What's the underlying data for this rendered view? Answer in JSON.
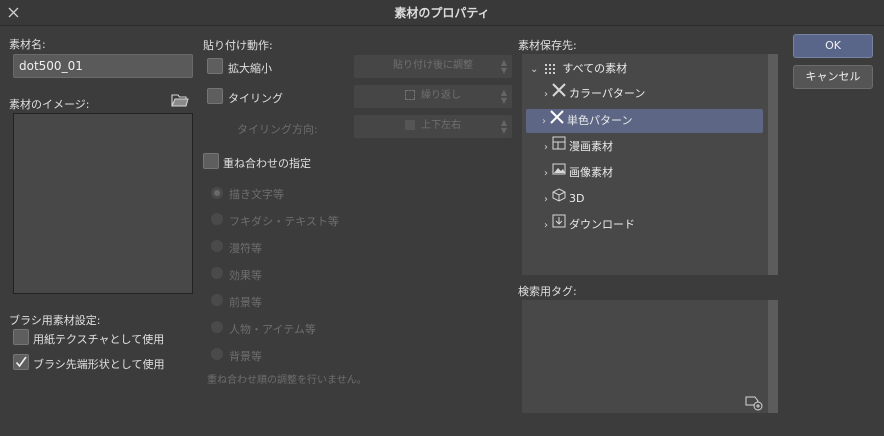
{
  "window": {
    "title": "素材のプロパティ"
  },
  "left": {
    "name_label": "素材名:",
    "name_value": "dot500_01",
    "image_label": "素材のイメージ:",
    "brush_section_label": "ブラシ用素材設定:",
    "paper_texture_label": "用紙テクスチャとして使用",
    "brush_tip_label": "ブラシ先端形状として使用"
  },
  "paste": {
    "section_label": "貼り付け動作:",
    "scale_label": "拡大縮小",
    "scale_combo": "貼り付け後に調整",
    "tiling_label": "タイリング",
    "tiling_combo": "繰り返し",
    "tiling_dir_label": "タイリング方向:",
    "tiling_dir_combo": "上下左右",
    "overlay_label": "重ね合わせの指定",
    "radios": [
      "描き文字等",
      "フキダシ・テキスト等",
      "漫符等",
      "効果等",
      "前景等",
      "人物・アイテム等",
      "背景等"
    ],
    "overlay_note": "重ね合わせ順の調整を行いません。"
  },
  "storage": {
    "section_label": "素材保存先:",
    "root": "すべての素材",
    "items": [
      "カラーパターン",
      "単色パターン",
      "漫画素材",
      "画像素材",
      "3D",
      "ダウンロード"
    ],
    "selected_index": 1
  },
  "tags": {
    "section_label": "検索用タグ:"
  },
  "buttons": {
    "ok": "OK",
    "cancel": "キャンセル"
  }
}
